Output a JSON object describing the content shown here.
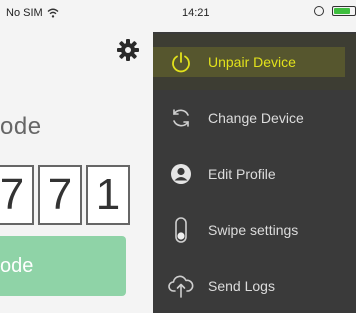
{
  "status_bar": {
    "carrier": "No SIM",
    "time": "14:21",
    "battery_level": 0.8
  },
  "main": {
    "code_label": "ode",
    "digits": [
      "7",
      "7",
      "1"
    ],
    "button_label": "ode"
  },
  "menu": {
    "items": [
      {
        "label": "Unpair Device",
        "icon": "power-icon",
        "active": true
      },
      {
        "label": "Change Device",
        "icon": "refresh-icon",
        "active": false
      },
      {
        "label": "Edit Profile",
        "icon": "profile-icon",
        "active": false
      },
      {
        "label": "Swipe settings",
        "icon": "swipe-icon",
        "active": false
      },
      {
        "label": "Send Logs",
        "icon": "cloud-upload-icon",
        "active": false
      }
    ]
  },
  "colors": {
    "drawer_bg": "#3a3a3a",
    "active_text": "#e8e81c",
    "menu_text": "#dcdcdc",
    "code_button_bg": "#8fd3a7",
    "battery_fill": "#3fbf3f"
  }
}
